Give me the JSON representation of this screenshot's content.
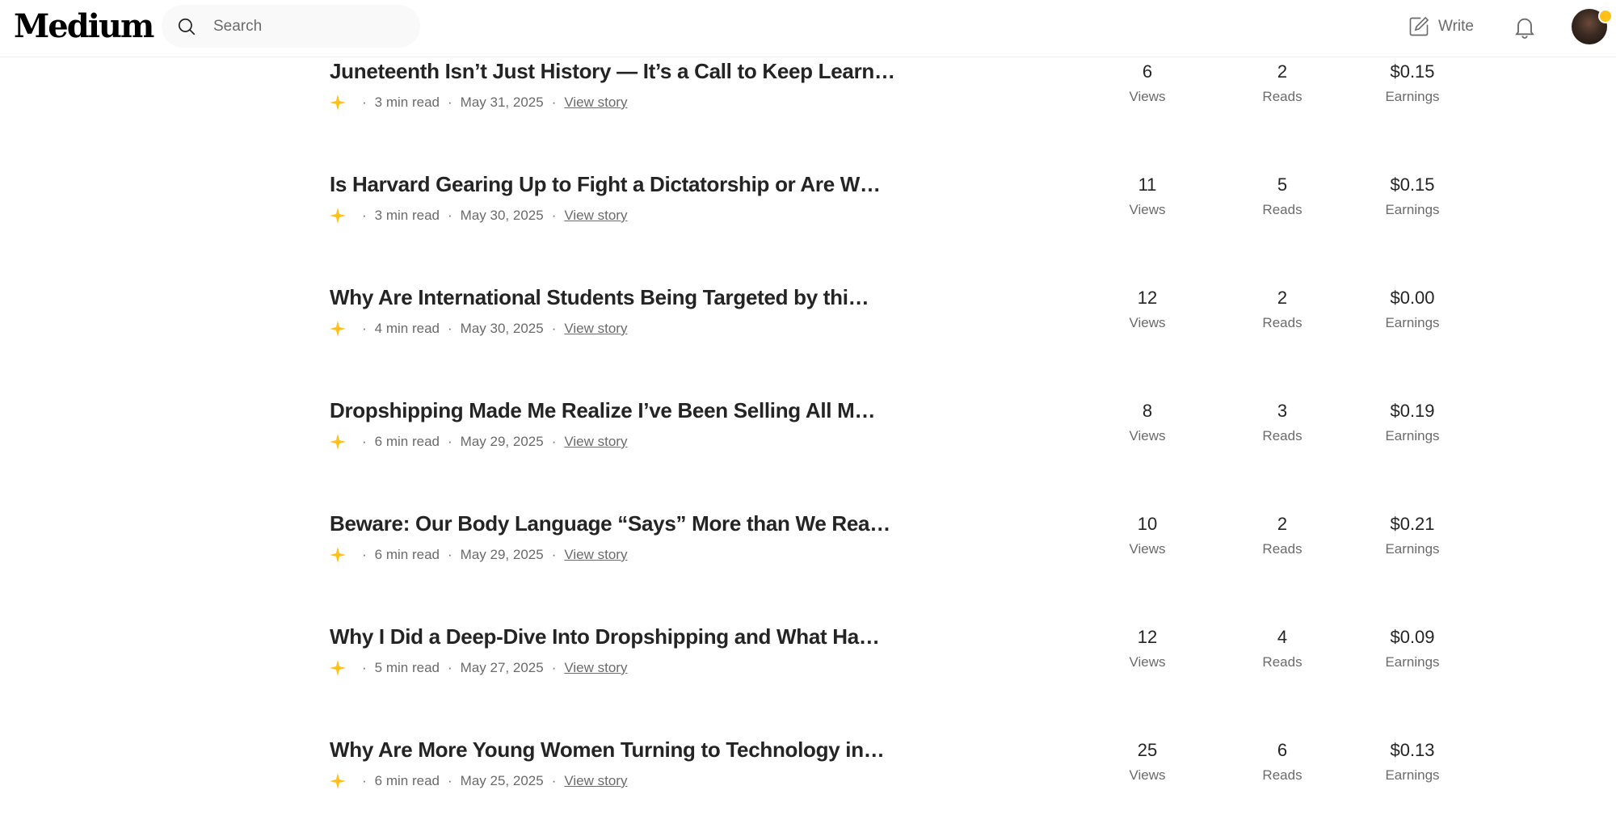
{
  "header": {
    "logo": "Medium",
    "search_placeholder": "Search",
    "write_label": "Write"
  },
  "stat_labels": {
    "views": "Views",
    "reads": "Reads",
    "earnings": "Earnings"
  },
  "colors": {
    "star": "#ffc017",
    "text": "#242424",
    "muted": "#6b6b6b"
  },
  "stories": [
    {
      "title": "Juneteenth Isn’t Just History — It’s a Call to Keep Learn…",
      "read_time": "3 min read",
      "date": "May 31, 2025",
      "link": "View story",
      "views": "6",
      "reads": "2",
      "earnings": "$0.15"
    },
    {
      "title": "Is Harvard Gearing Up to Fight a Dictatorship or Are W…",
      "read_time": "3 min read",
      "date": "May 30, 2025",
      "link": "View story",
      "views": "11",
      "reads": "5",
      "earnings": "$0.15"
    },
    {
      "title": "Why Are International Students Being Targeted by thi…",
      "read_time": "4 min read",
      "date": "May 30, 2025",
      "link": "View story",
      "views": "12",
      "reads": "2",
      "earnings": "$0.00"
    },
    {
      "title": "Dropshipping Made Me Realize I’ve Been Selling All M…",
      "read_time": "6 min read",
      "date": "May 29, 2025",
      "link": "View story",
      "views": "8",
      "reads": "3",
      "earnings": "$0.19"
    },
    {
      "title": "Beware: Our Body Language “Says” More than We Rea…",
      "read_time": "6 min read",
      "date": "May 29, 2025",
      "link": "View story",
      "views": "10",
      "reads": "2",
      "earnings": "$0.21"
    },
    {
      "title": "Why I Did a Deep-Dive Into Dropshipping and What Ha…",
      "read_time": "5 min read",
      "date": "May 27, 2025",
      "link": "View story",
      "views": "12",
      "reads": "4",
      "earnings": "$0.09"
    },
    {
      "title": "Why Are More Young Women Turning to Technology in…",
      "read_time": "6 min read",
      "date": "May 25, 2025",
      "link": "View story",
      "views": "25",
      "reads": "6",
      "earnings": "$0.13"
    }
  ]
}
